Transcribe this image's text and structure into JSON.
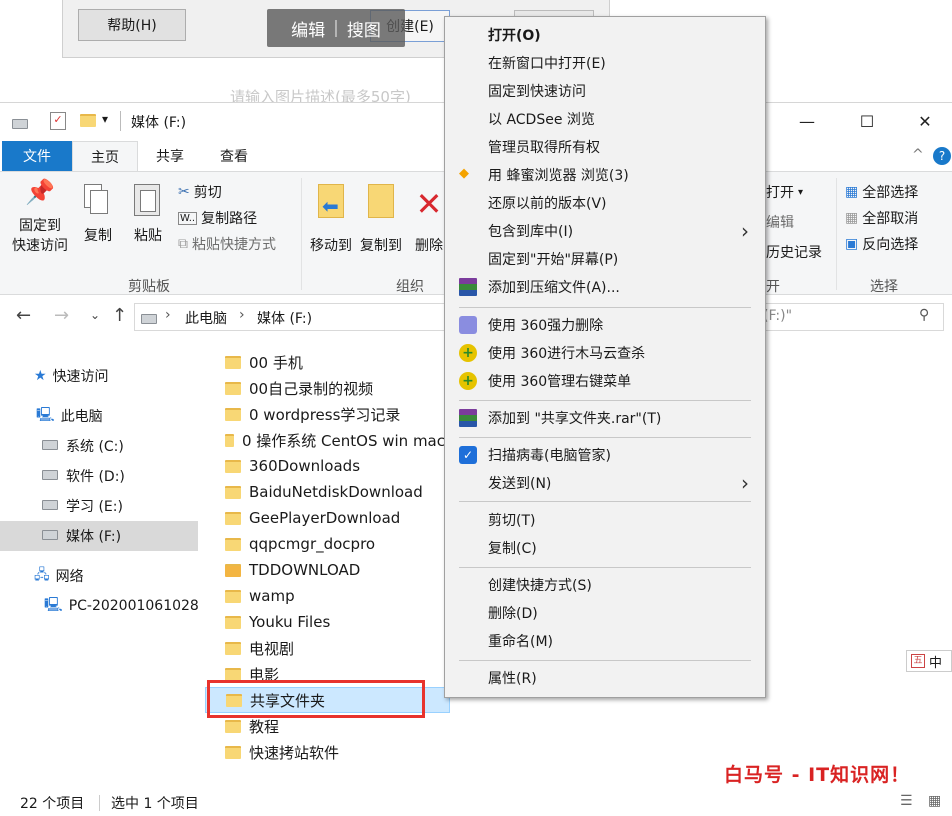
{
  "background_dialog": {
    "help_button": "帮助(H)",
    "toolbar_edit": "编辑",
    "toolbar_divider": "|",
    "toolbar_search": "搜图",
    "create_button": "创建(E)",
    "description_hint": "请输入图片描述(最多50字)"
  },
  "window": {
    "title": "媒体 (F:)",
    "quick_toolbar_caret": "▾",
    "controls": {
      "minimize": "—",
      "maximize": "☐",
      "close": "✕"
    }
  },
  "ribbon": {
    "tabs": {
      "file": "文件",
      "home": "主页",
      "share": "共享",
      "view": "查看"
    },
    "collapse": "^",
    "help": "?",
    "clipboard": {
      "label": "剪贴板",
      "pin": "固定到\n快速访问",
      "pin_line1": "固定到",
      "pin_line2": "快速访问",
      "copy": "复制",
      "paste": "粘贴",
      "cut": "剪切",
      "copy_path": "复制路径",
      "paste_shortcut": "粘贴快捷方式"
    },
    "organize": {
      "label": "组织",
      "move_to": "移动到",
      "copy_to": "复制到",
      "delete": "删除"
    },
    "open": {
      "label": "开",
      "open": "打开",
      "edit": "编辑",
      "history": "历史记录"
    },
    "select": {
      "label": "选择",
      "select_all": "全部选择",
      "select_none": "全部取消",
      "invert": "反向选择"
    }
  },
  "address": {
    "path": [
      "此电脑",
      "媒体 (F:)"
    ],
    "separator": "›",
    "search_placeholder": "(F:)\""
  },
  "nav": {
    "quick_access": "快速访问",
    "this_pc": "此电脑",
    "system": "系统 (C:)",
    "software": "软件 (D:)",
    "study": "学习 (E:)",
    "media": "媒体 (F:)",
    "network": "网络",
    "pc_name": "PC-202001061028"
  },
  "files": [
    "00 手机",
    "00自己录制的视频",
    "0 wordpress学习记录",
    "0 操作系统 CentOS win mac",
    "360Downloads",
    "BaiduNetdiskDownload",
    "GeePlayerDownload",
    "qqpcmgr_docpro",
    "TDDOWNLOAD",
    "wamp",
    "Youku Files",
    "电视剧",
    "电影",
    "共享文件夹",
    "教程",
    "快速拷站软件"
  ],
  "status": {
    "item_count": "22 个项目",
    "selected": "选中 1 个项目"
  },
  "context_menu": {
    "open": "打开(O)",
    "open_new_window": "在新窗口中打开(E)",
    "pin_quick_access": "固定到快速访问",
    "acdsee": "以 ACDSee 浏览",
    "take_ownership": "管理员取得所有权",
    "honey_browser": "用 蜂蜜浏览器 浏览(3)",
    "restore_versions": "还原以前的版本(V)",
    "include_library": "包含到库中(I)",
    "pin_start": "固定到\"开始\"屏幕(P)",
    "add_archive": "添加到压缩文件(A)...",
    "del_360": "使用 360强力删除",
    "scan_360": "使用 360进行木马云查杀",
    "manage_360": "使用 360管理右键菜单",
    "add_rar": "添加到 \"共享文件夹.rar\"(T)",
    "scan_virus": "扫描病毒(电脑管家)",
    "send_to": "发送到(N)",
    "cut": "剪切(T)",
    "copy": "复制(C)",
    "create_shortcut": "创建快捷方式(S)",
    "delete": "删除(D)",
    "rename": "重命名(M)",
    "properties": "属性(R)",
    "submenu_arrow": "›"
  },
  "ime": "中",
  "watermark": "白马号 - IT知识网！",
  "colors": {
    "accent": "#1979ca",
    "selection": "#cce8ff",
    "highlight_box": "#e8332d",
    "menu_bg": "#f2f2f2"
  }
}
